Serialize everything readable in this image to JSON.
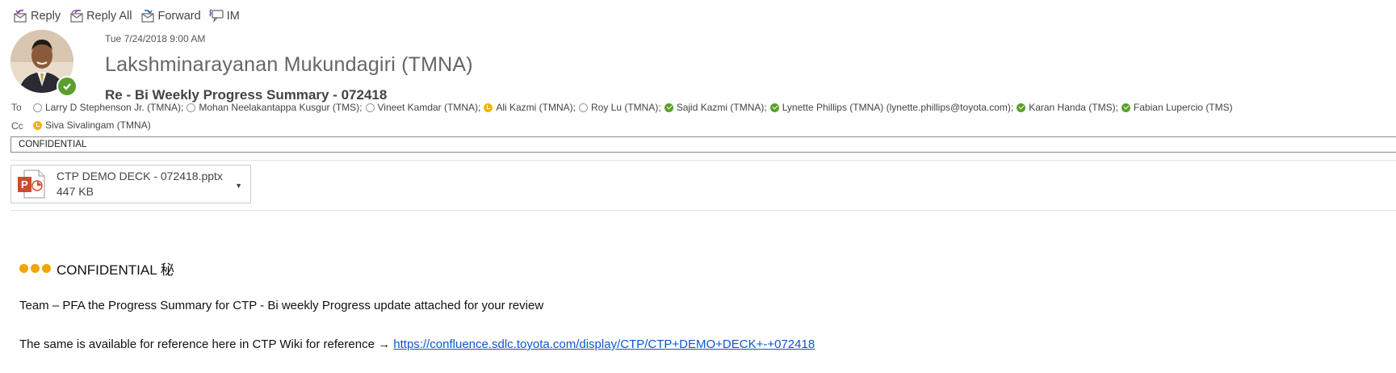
{
  "toolbar": {
    "reply": "Reply",
    "reply_all": "Reply All",
    "forward": "Forward",
    "im": "IM"
  },
  "header": {
    "date": "Tue 7/24/2018 9:00 AM",
    "sender": "Lakshminarayanan Mukundagiri (TMNA)",
    "subject": "Re - Bi Weekly Progress Summary - 072418",
    "to_label": "To",
    "cc_label": "Cc"
  },
  "to": [
    {
      "name": "Larry D Stephenson Jr. (TMNA);",
      "status": "offline"
    },
    {
      "name": "Mohan Neelakantappa Kusgur (TMS);",
      "status": "offline"
    },
    {
      "name": "Vineet Kamdar (TMNA);",
      "status": "offline"
    },
    {
      "name": "Ali Kazmi (TMNA);",
      "status": "away"
    },
    {
      "name": "Roy Lu (TMNA);",
      "status": "offline"
    },
    {
      "name": "Sajid Kazmi (TMNA);",
      "status": "available"
    },
    {
      "name": "Lynette Phillips (TMNA) (lynette.phillips@toyota.com);",
      "status": "available"
    },
    {
      "name": "Karan Handa (TMS);",
      "status": "available"
    },
    {
      "name": "Fabian Lupercio (TMS)",
      "status": "available"
    }
  ],
  "cc": [
    {
      "name": "Siva Sivalingam (TMNA)",
      "status": "away"
    }
  ],
  "classification": "CONFIDENTIAL",
  "attachment": {
    "filename": "CTP DEMO DECK - 072418.pptx",
    "size": "447 KB"
  },
  "body": {
    "confidential_label": "CONFIDENTIAL 秘",
    "line1": "Team – PFA the Progress Summary for CTP - Bi weekly Progress update attached for your review",
    "line2_text": "The same is available for reference here in CTP Wiki for reference",
    "line2_arrow": "→",
    "link": "https://confluence.sdlc.toyota.com/display/CTP/CTP+DEMO+DECK+-+072418"
  },
  "colors": {
    "available": "#5aa02c",
    "away": "#f4b400",
    "link": "#1155cc",
    "confidential_dots": "#f4a400"
  }
}
